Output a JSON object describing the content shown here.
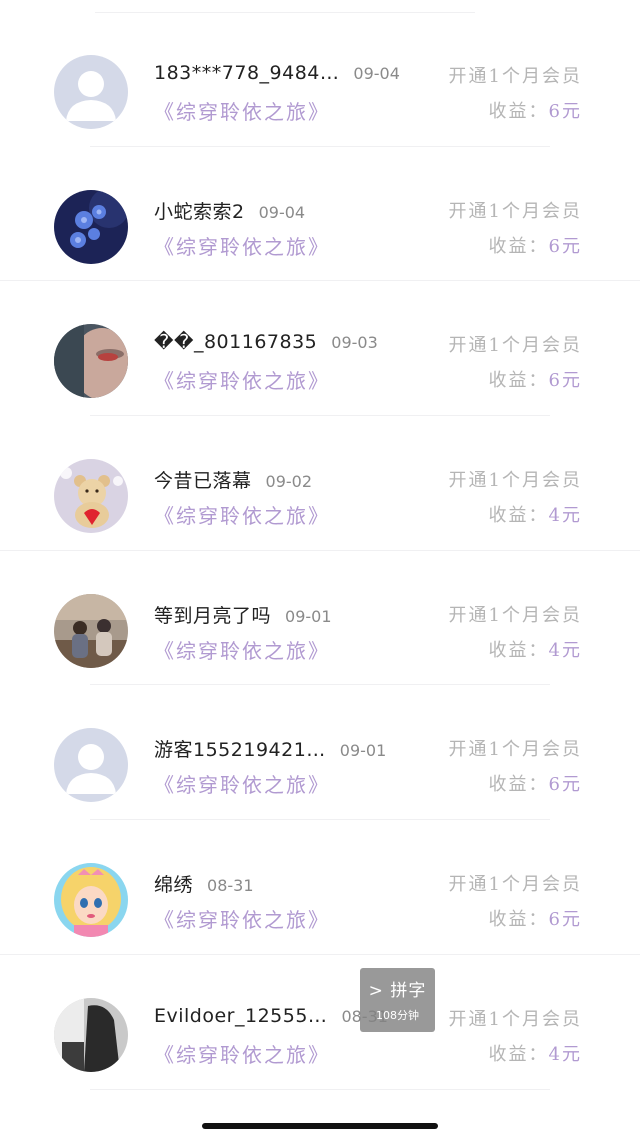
{
  "rows": [
    {
      "name": "183***778_9484…",
      "date": "09-04",
      "book": "《综穿聆依之旅》",
      "action": "开通1个月会员",
      "earning_label": "收益：",
      "earning_amount": "6元",
      "avatar": "default-avatar"
    },
    {
      "name": "小蛇索索2",
      "date": "09-04",
      "book": "《综穿聆依之旅》",
      "action": "开通1个月会员",
      "earning_label": "收益：",
      "earning_amount": "6元",
      "avatar": "blue-flowers-avatar"
    },
    {
      "name": "��_801167835",
      "date": "09-03",
      "book": "《综穿聆依之旅》",
      "action": "开通1个月会员",
      "earning_label": "收益：",
      "earning_amount": "6元",
      "avatar": "face-photo-avatar"
    },
    {
      "name": "今昔已落幕",
      "date": "09-02",
      "book": "《综穿聆依之旅》",
      "action": "开通1个月会员",
      "earning_label": "收益：",
      "earning_amount": "4元",
      "avatar": "teddy-bear-avatar"
    },
    {
      "name": "等到月亮了吗",
      "date": "09-01",
      "book": "《综穿聆依之旅》",
      "action": "开通1个月会员",
      "earning_label": "收益：",
      "earning_amount": "4元",
      "avatar": "couple-photo-avatar"
    },
    {
      "name": "游客155219421…",
      "date": "09-01",
      "book": "《综穿聆依之旅》",
      "action": "开通1个月会员",
      "earning_label": "收益：",
      "earning_amount": "6元",
      "avatar": "default-avatar"
    },
    {
      "name": "绵绣",
      "date": "08-31",
      "book": "《综穿聆依之旅》",
      "action": "开通1个月会员",
      "earning_label": "收益：",
      "earning_amount": "6元",
      "avatar": "cartoon-girl-avatar"
    },
    {
      "name": "Evildoer_12555…",
      "date": "08-31",
      "book": "《综穿聆依之旅》",
      "action": "开通1个月会员",
      "earning_label": "收益：",
      "earning_amount": "4元",
      "avatar": "dark-photo-avatar"
    }
  ],
  "overlay": {
    "label": "> 拼字",
    "sub": "108分钟"
  },
  "colors": {
    "accent": "#b19ad1",
    "muted": "#b5b5b5"
  }
}
